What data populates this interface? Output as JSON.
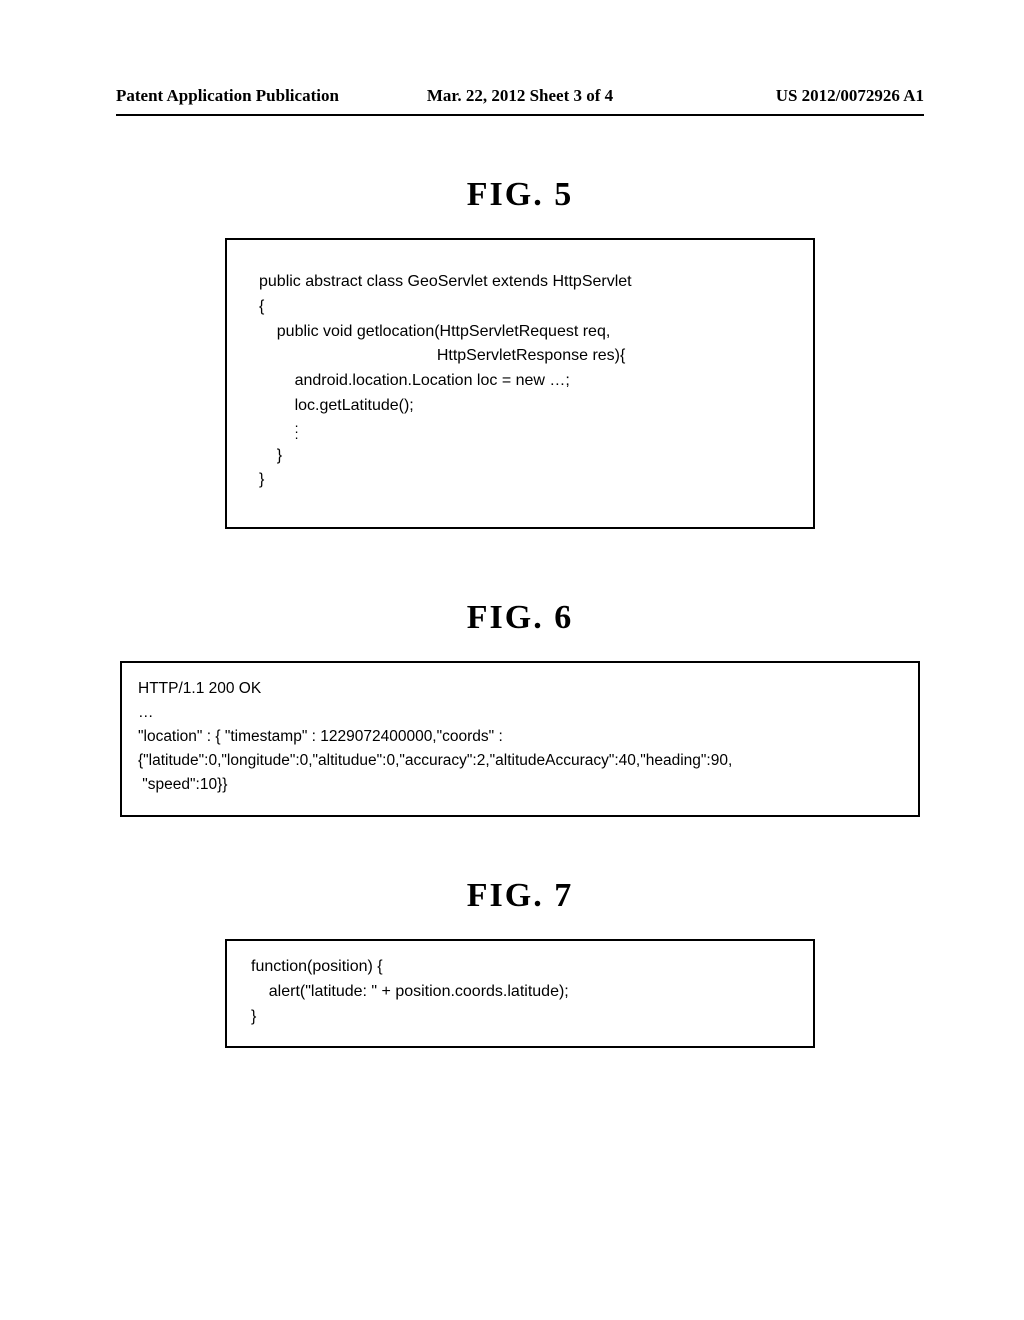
{
  "header": {
    "left": "Patent Application Publication",
    "middle": "Mar. 22, 2012  Sheet 3 of 4",
    "right": "US 2012/0072926 A1"
  },
  "figures": {
    "fig5": {
      "label": "FIG.  5",
      "code_l1": "public abstract class GeoServlet extends HttpServlet",
      "code_l2": "{",
      "code_l3": "    public void getlocation(HttpServletRequest req,",
      "code_l4": "                                        HttpServletResponse res){",
      "code_l5": "        android.location.Location loc = new …;",
      "code_l6": "        loc.getLatitude();",
      "code_l7_pad": "        ",
      "code_l8": "    }",
      "code_l9": "}"
    },
    "fig6": {
      "label": "FIG.  6",
      "code_l1": "HTTP/1.1 200 OK",
      "code_l2": "…",
      "code_l3": "\"location\" : { \"timestamp\" : 1229072400000,\"coords\" :",
      "code_l4": "{\"latitude\":0,\"longitude\":0,\"altitudue\":0,\"accuracy\":2,\"altitudeAccuracy\":40,\"heading\":90,",
      "code_l5": " \"speed\":10}}"
    },
    "fig7": {
      "label": "FIG.  7",
      "code_l1": "function(position) {",
      "code_l2": "    alert(\"latitude: \" + position.coords.latitude);",
      "code_l3": "}"
    }
  }
}
